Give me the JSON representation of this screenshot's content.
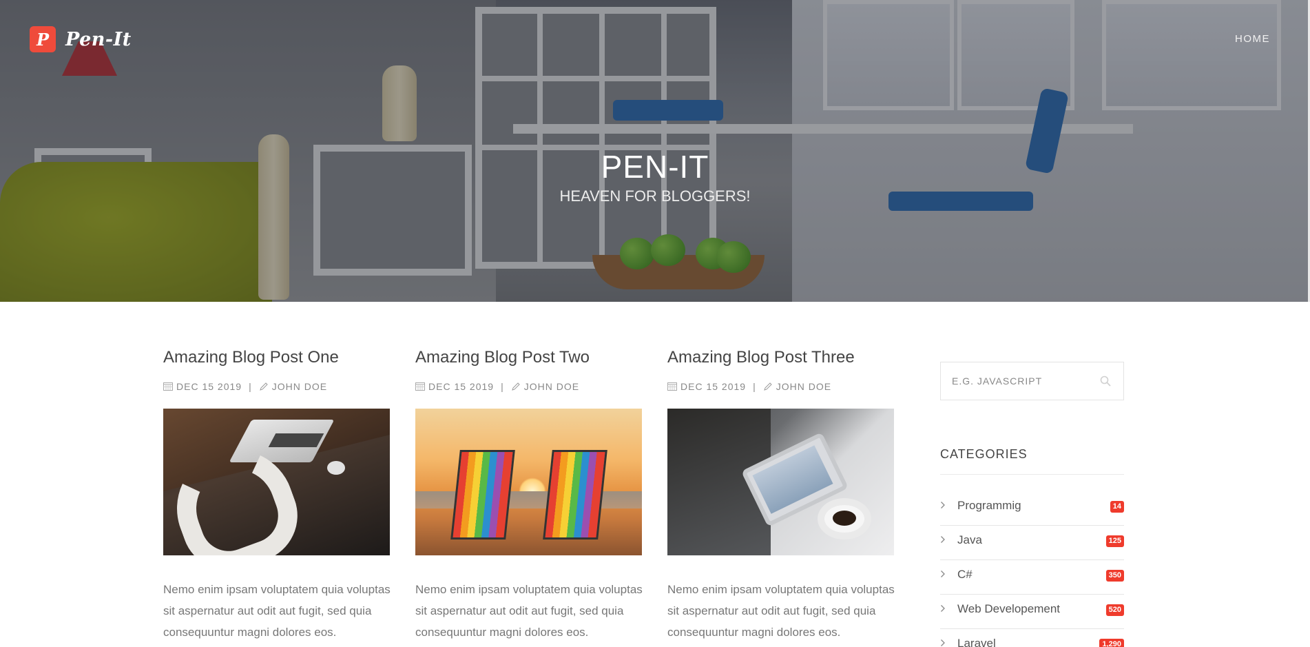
{
  "brand": {
    "logo_letter": "P",
    "name": "Pen-It"
  },
  "nav": {
    "home": "HOME"
  },
  "hero": {
    "title": "PEN-IT",
    "subtitle": "HEAVEN FOR BLOGGERS!"
  },
  "posts": [
    {
      "title": "Amazing Blog Post One",
      "date": "DEC 15 2019",
      "separator": "|",
      "author": "JOHN DOE",
      "excerpt": "Nemo enim ipsam voluptatem quia voluptas sit aspernatur aut odit aut fugit, sed quia consequuntur magni dolores eos."
    },
    {
      "title": "Amazing Blog Post Two",
      "date": "DEC 15 2019",
      "separator": "|",
      "author": "JOHN DOE",
      "excerpt": "Nemo enim ipsam voluptatem quia voluptas sit aspernatur aut odit aut fugit, sed quia consequuntur magni dolores eos."
    },
    {
      "title": "Amazing Blog Post Three",
      "date": "DEC 15 2019",
      "separator": "|",
      "author": "JOHN DOE",
      "excerpt": "Nemo enim ipsam voluptatem quia voluptas sit aspernatur aut odit aut fugit, sed quia consequuntur magni dolores eos."
    }
  ],
  "sidebar": {
    "search": {
      "placeholder": "E.G. JAVASCRIPT",
      "value": ""
    },
    "categories_title": "CATEGORIES",
    "categories": [
      {
        "label": "Programmig",
        "count": "14"
      },
      {
        "label": "Java",
        "count": "125"
      },
      {
        "label": "C#",
        "count": "350"
      },
      {
        "label": "Web Developement",
        "count": "520"
      },
      {
        "label": "Laravel",
        "count": "1,290"
      }
    ]
  },
  "icons": {
    "calendar": "calendar-icon",
    "pencil": "pencil-icon",
    "search": "search-icon",
    "chevron": "chevron-right-icon"
  },
  "colors": {
    "accent": "#ef4b3b",
    "badge": "#ef3b2c",
    "title": "#444444",
    "text": "#777777"
  }
}
